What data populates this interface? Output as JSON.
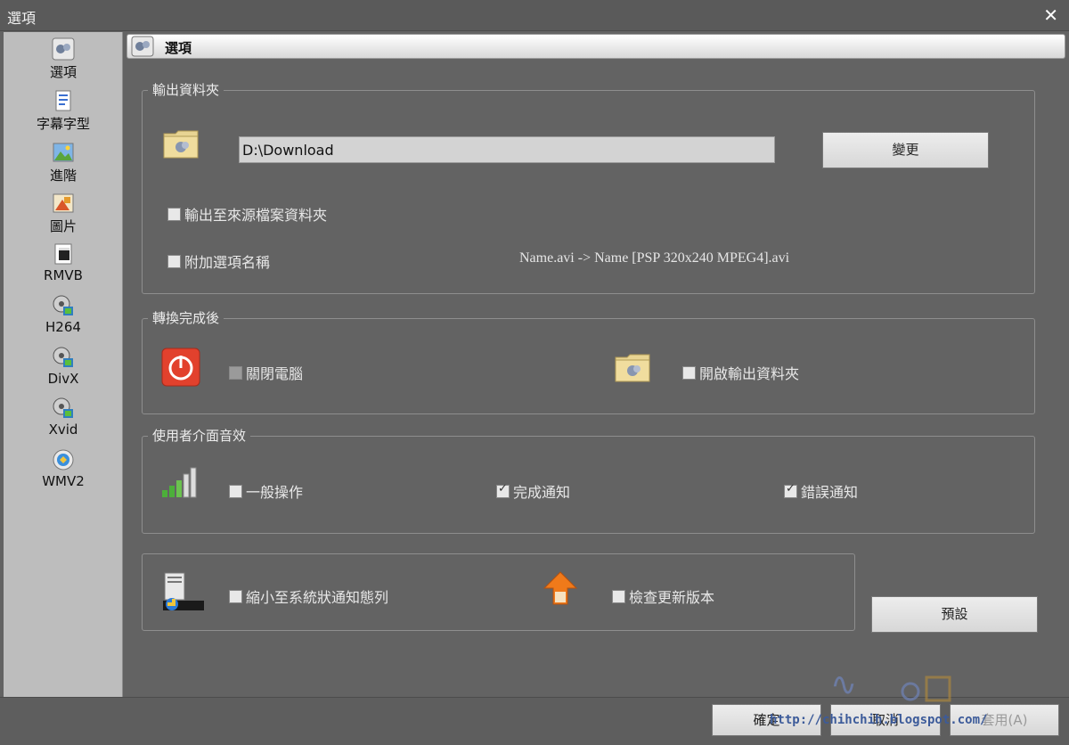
{
  "window": {
    "title": "選項",
    "close_label": "✕"
  },
  "sidebar": {
    "items": [
      {
        "label": "選項",
        "icon": "options-icon"
      },
      {
        "label": "字幕字型",
        "icon": "subtitle-font-icon"
      },
      {
        "label": "進階",
        "icon": "advanced-icon"
      },
      {
        "label": "圖片",
        "icon": "image-icon"
      },
      {
        "label": "RMVB",
        "icon": "rmvb-icon"
      },
      {
        "label": "H264",
        "icon": "h264-icon"
      },
      {
        "label": "DivX",
        "icon": "divx-icon"
      },
      {
        "label": "Xvid",
        "icon": "xvid-icon"
      },
      {
        "label": "WMV2",
        "icon": "wmv2-icon"
      }
    ]
  },
  "header": {
    "title": "選項"
  },
  "output_folder": {
    "legend": "輸出資料夾",
    "path": "D:\\Download",
    "change_button": "變更",
    "output_to_source_label": "輸出至來源檔案資料夾",
    "output_to_source_checked": false,
    "append_option_name_label": "附加選項名稱",
    "append_option_name_checked": false,
    "example": "Name.avi  -> Name [PSP 320x240 MPEG4].avi"
  },
  "after_conversion": {
    "legend": "轉換完成後",
    "shutdown_label": "關閉電腦",
    "shutdown_checked": false,
    "open_folder_label": "開啟輸出資料夾",
    "open_folder_checked": false
  },
  "ui_sounds": {
    "legend": "使用者介面音效",
    "general_label": "一般操作",
    "general_checked": false,
    "complete_label": "完成通知",
    "complete_checked": true,
    "error_label": "錯誤通知",
    "error_checked": true
  },
  "misc": {
    "minimize_tray_label": "縮小至系統狀通知態列",
    "minimize_tray_checked": false,
    "check_update_label": "檢查更新版本",
    "check_update_checked": false,
    "default_button": "預設"
  },
  "footer": {
    "ok_button": "確定",
    "cancel_button": "取消",
    "apply_button": "套用(A)",
    "watermark": "http://chihchih.blogspot.com/"
  },
  "colors": {
    "accent_red": "#e2412d",
    "folder_yellow": "#e8d493",
    "arrow_orange": "#f07a1a"
  }
}
